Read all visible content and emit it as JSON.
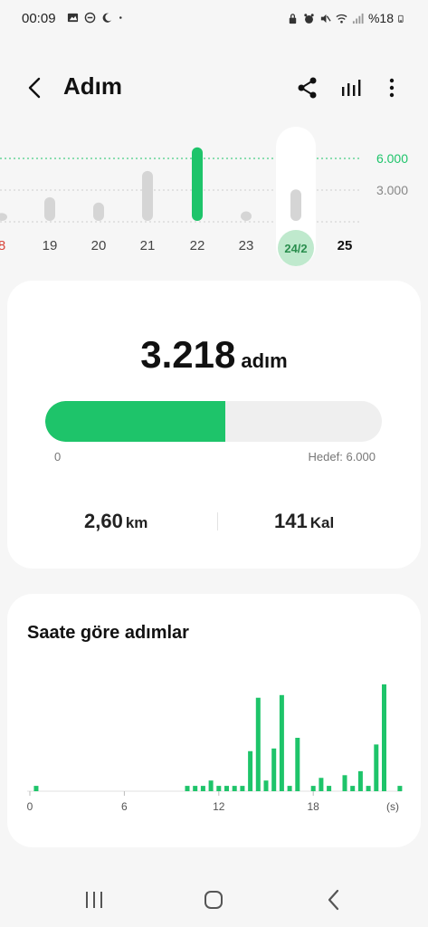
{
  "status_bar": {
    "time": "00:09",
    "battery": "%18"
  },
  "header": {
    "title": "Adım"
  },
  "week_chart": {
    "axis_labels": [
      "6.000",
      "3.000"
    ],
    "goal_color": "#1ec46a",
    "days": [
      {
        "label": "8",
        "value": 0.15,
        "style": "red"
      },
      {
        "label": "19",
        "value": 0.45,
        "style": "normal"
      },
      {
        "label": "20",
        "value": 0.35,
        "style": "normal"
      },
      {
        "label": "21",
        "value": 0.95,
        "style": "normal"
      },
      {
        "label": "22",
        "value": 1.4,
        "style": "highlight"
      },
      {
        "label": "23",
        "value": 0.18,
        "style": "normal"
      },
      {
        "label": "24/2",
        "value": 0.6,
        "style": "selected"
      },
      {
        "label": "25",
        "value": 0,
        "style": "bold"
      }
    ]
  },
  "summary": {
    "steps": "3.218",
    "steps_unit": "adım",
    "progress_fraction": 0.536,
    "progress_min": "0",
    "progress_goal": "Hedef: 6.000",
    "distance_value": "2,60",
    "distance_unit": "km",
    "calories_value": "141",
    "calories_unit": "Kal",
    "accent_color": "#1ec46a"
  },
  "hourly": {
    "title": "Saate göre adımlar",
    "x_labels": [
      "0",
      "6",
      "12",
      "18",
      "(s)"
    ],
    "bars": [
      {
        "h": 0.4,
        "v": 4
      },
      {
        "h": 10,
        "v": 4
      },
      {
        "h": 10.5,
        "v": 4
      },
      {
        "h": 11,
        "v": 4
      },
      {
        "h": 11.5,
        "v": 8
      },
      {
        "h": 12,
        "v": 4
      },
      {
        "h": 12.5,
        "v": 4
      },
      {
        "h": 13,
        "v": 4
      },
      {
        "h": 13.5,
        "v": 4
      },
      {
        "h": 14,
        "v": 30
      },
      {
        "h": 14.5,
        "v": 70
      },
      {
        "h": 15,
        "v": 8
      },
      {
        "h": 15.5,
        "v": 32
      },
      {
        "h": 16,
        "v": 72
      },
      {
        "h": 16.5,
        "v": 4
      },
      {
        "h": 17,
        "v": 40
      },
      {
        "h": 18,
        "v": 4
      },
      {
        "h": 18.5,
        "v": 10
      },
      {
        "h": 19,
        "v": 4
      },
      {
        "h": 20,
        "v": 12
      },
      {
        "h": 20.5,
        "v": 4
      },
      {
        "h": 21,
        "v": 15
      },
      {
        "h": 21.5,
        "v": 4
      },
      {
        "h": 22,
        "v": 35
      },
      {
        "h": 22.5,
        "v": 80
      },
      {
        "h": 23.5,
        "v": 4
      }
    ]
  }
}
